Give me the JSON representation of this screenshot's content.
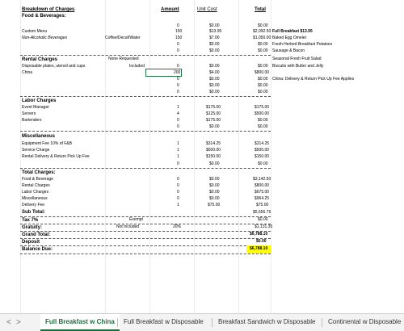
{
  "sheet": {
    "title": "Breakdown of Charges",
    "subtitle": "Food & Beverages:",
    "headers": {
      "amount": "Amount",
      "unit_cost": "Unit Cost",
      "total": "Total"
    },
    "food": [
      {
        "label": "",
        "note": "",
        "amount": "0",
        "unit": "$0.00",
        "total": "$0.00"
      },
      {
        "label": "Custom Menu",
        "note": "",
        "amount": "150",
        "unit": "$13.95",
        "total": "$2,092.50"
      },
      {
        "label": "Non-Alcoholic Beverages",
        "note": "Coffee/Decaf/Water",
        "amount": "150",
        "unit": "$7.00",
        "total": "$1,050.00"
      },
      {
        "label": "",
        "note": "",
        "amount": "0",
        "unit": "$0.00",
        "total": "$0.00"
      },
      {
        "label": "",
        "note": "",
        "amount": "0",
        "unit": "$0.00",
        "total": "$0.00"
      }
    ],
    "rental": {
      "header": "Rental Charges",
      "header_note": "None Requested",
      "rows": [
        {
          "label": "Disposable plates, utensil and cups",
          "note": "Included",
          "amount": "0",
          "unit": "$0.00",
          "total": "$0.00"
        },
        {
          "label": "China",
          "note": "",
          "amount": "200",
          "unit": "$4.00",
          "total": "$800.00"
        },
        {
          "label": "",
          "note": "",
          "amount": "0",
          "unit": "$0.00",
          "total": "$0.00"
        },
        {
          "label": "",
          "note": "",
          "amount": "0",
          "unit": "$0.00",
          "total": "$0.00"
        },
        {
          "label": "",
          "note": "",
          "amount": "0",
          "unit": "$0.00",
          "total": "$0.00"
        }
      ]
    },
    "labor": {
      "header": "Labor Charges",
      "rows": [
        {
          "label": "Event Manager",
          "amount": "1",
          "unit": "$175.00",
          "total": "$175.00"
        },
        {
          "label": "Servers",
          "amount": "4",
          "unit": "$125.00",
          "total": "$500.00"
        },
        {
          "label": "Bartenders",
          "amount": "0",
          "unit": "$175.00",
          "total": "$0.00"
        },
        {
          "label": "",
          "amount": "0",
          "unit": "$0.00",
          "total": "$0.00"
        }
      ]
    },
    "misc": {
      "header": "Miscellaneous",
      "rows": [
        {
          "label": "Equipment Fee 10% of F&B",
          "amount": "1",
          "unit": "$314.25",
          "total": "$314.25"
        },
        {
          "label": "Service Charge",
          "amount": "1",
          "unit": "$500.00",
          "total": "$500.00"
        },
        {
          "label": "Rental Delivery & Return Pick Up Fee",
          "amount": "1",
          "unit": "$150.00",
          "total": "$150.00"
        },
        {
          "label": "",
          "amount": "0",
          "unit": "$0.00",
          "total": "$0.00"
        }
      ]
    },
    "totals": {
      "header": "Total Charges:",
      "rows": [
        {
          "label": "Food & Beverage",
          "amount": "0",
          "unit": "$0.00",
          "total": "$3,142.50"
        },
        {
          "label": "Rental Charges",
          "amount": "0",
          "unit": "$0.00",
          "total": "$800.00"
        },
        {
          "label": "Labor Charges",
          "amount": "0",
          "unit": "$0.00",
          "total": "$675.00"
        },
        {
          "label": "Miscellaneous",
          "amount": "0",
          "unit": "$0.00",
          "total": "$964.25"
        },
        {
          "label": "Delivery Fee",
          "amount": "1",
          "unit": "$75.00",
          "total": "$75.00"
        }
      ],
      "sub_total_label": "Sub Total:",
      "sub_total": "$5,656.75",
      "tax_label": "Tax 7%",
      "tax_note": "Exempt",
      "tax": "$0.00",
      "gratuity_label": "Gratuity:",
      "gratuity_note": "Not Included",
      "gratuity_pct": "20%",
      "gratuity": "$1,131.35",
      "grand_total_label": "Grand Total:",
      "grand_total": "$6,788.10",
      "deposit_label": "Deposit",
      "deposit": "$0.00",
      "balance_label": "Balance Due:",
      "balance": "$6,788.10"
    },
    "side": {
      "menu_title": "Full Breakfast $13.95",
      "menu_items": [
        "Baked Egg Omelet",
        "Fresh Herbed Breakfast Potatoes",
        "Sausage & Bacon",
        "Seasonal Fresh Fruit Salad",
        "Biscuits with Butter and Jelly"
      ],
      "china_note": "China: Delivery & Return Pick Up Fee Applies"
    }
  },
  "tabs": {
    "prev": "<",
    "next": ">",
    "items": [
      "Full Breakfast w China",
      "Full Breakfast w Disposable",
      "Breakfast Sandwich w Disposable",
      "Continental w Disposable"
    ]
  },
  "colors": {
    "accent": "#1e6e3c",
    "highlight": "#ffff00",
    "selection": "#217346"
  }
}
